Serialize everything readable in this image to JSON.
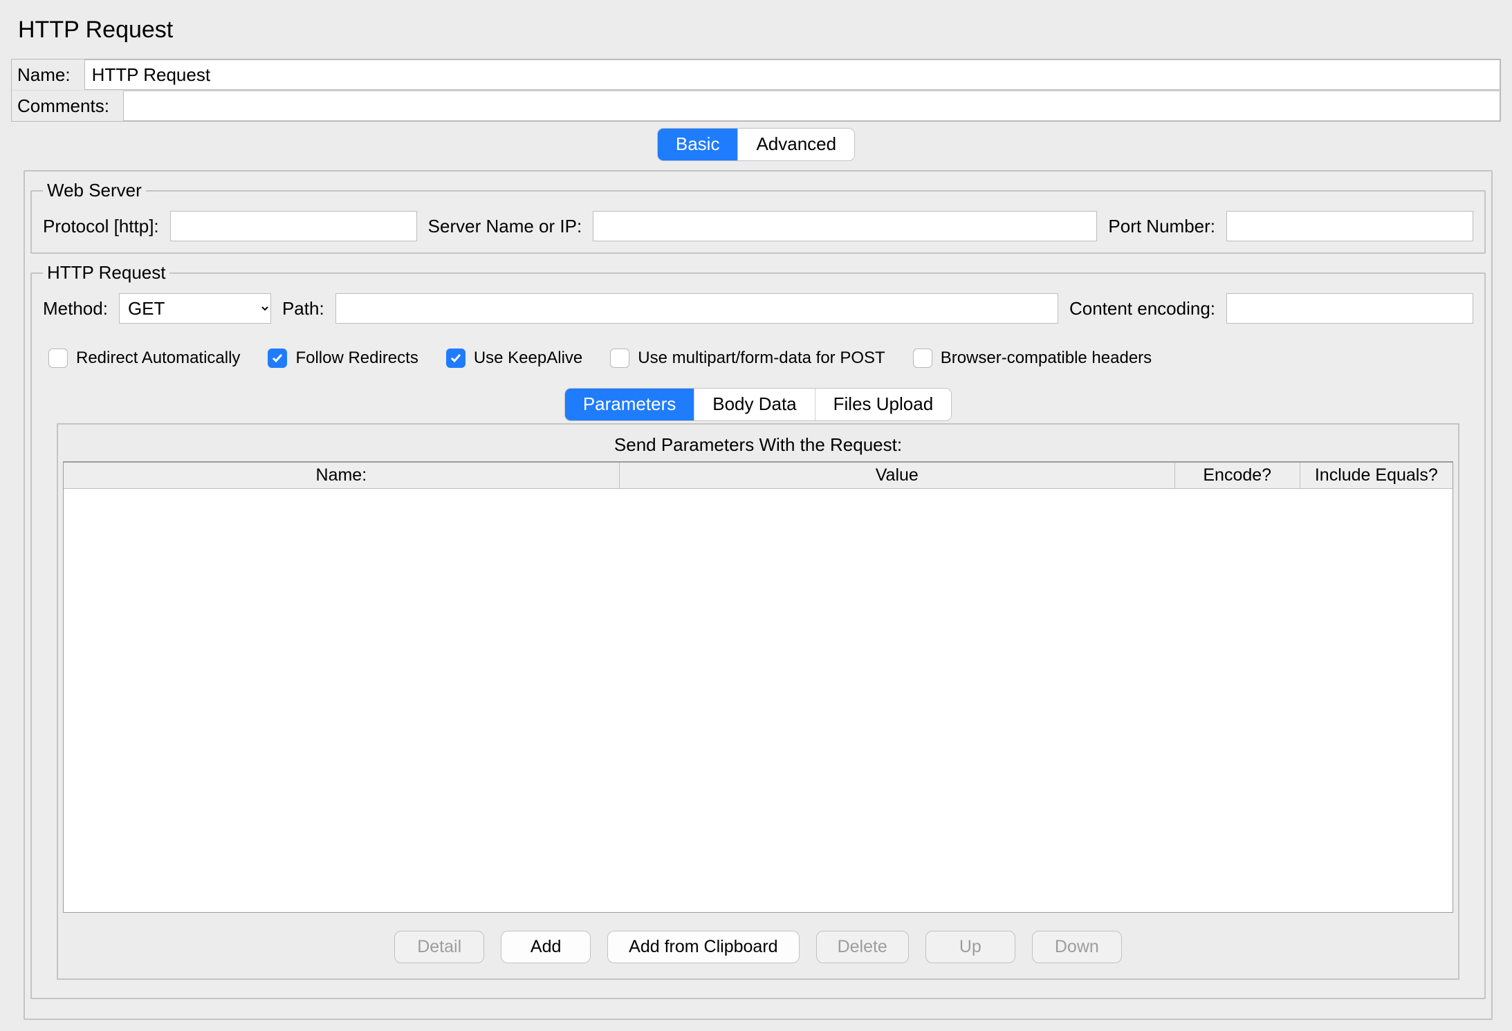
{
  "title": "HTTP Request",
  "top": {
    "name_label": "Name:",
    "name_value": "HTTP Request",
    "comments_label": "Comments:",
    "comments_value": ""
  },
  "tabs": {
    "basic": "Basic",
    "advanced": "Advanced",
    "selected": "basic"
  },
  "webserver": {
    "legend": "Web Server",
    "protocol_label": "Protocol [http]:",
    "protocol_value": "",
    "server_label": "Server Name or IP:",
    "server_value": "",
    "port_label": "Port Number:",
    "port_value": ""
  },
  "httpreq": {
    "legend": "HTTP Request",
    "method_label": "Method:",
    "method_value": "GET",
    "path_label": "Path:",
    "path_value": "",
    "encoding_label": "Content encoding:",
    "encoding_value": ""
  },
  "checks": {
    "redirect_auto": {
      "label": "Redirect Automatically",
      "checked": false
    },
    "follow_redirects": {
      "label": "Follow Redirects",
      "checked": true
    },
    "keepalive": {
      "label": "Use KeepAlive",
      "checked": true
    },
    "multipart": {
      "label": "Use multipart/form-data for POST",
      "checked": false
    },
    "browser_compat": {
      "label": "Browser-compatible headers",
      "checked": false
    }
  },
  "params_tabs": {
    "parameters": "Parameters",
    "body_data": "Body Data",
    "files": "Files Upload",
    "selected": "parameters"
  },
  "params": {
    "title": "Send Parameters With the Request:",
    "columns": {
      "name": "Name:",
      "value": "Value",
      "encode": "Encode?",
      "include_equals": "Include Equals?"
    },
    "rows": []
  },
  "buttons": {
    "detail": "Detail",
    "add": "Add",
    "add_clipboard": "Add from Clipboard",
    "delete": "Delete",
    "up": "Up",
    "down": "Down"
  }
}
